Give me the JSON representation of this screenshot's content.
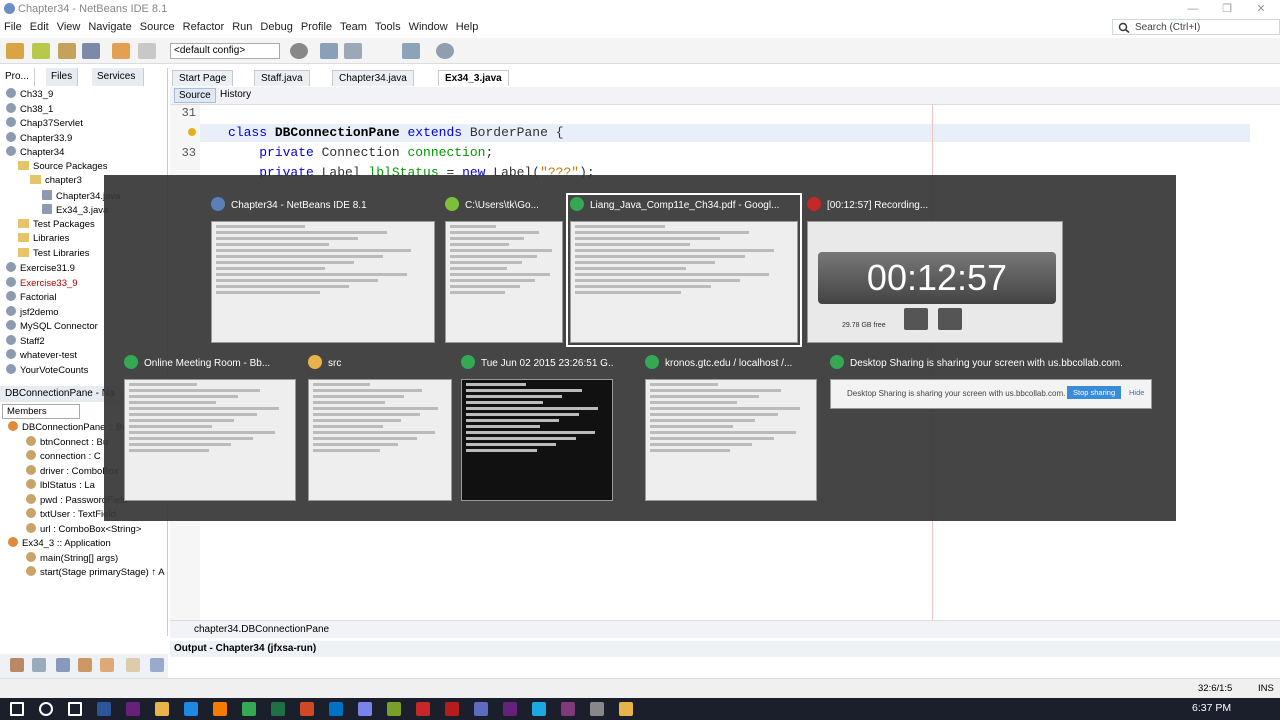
{
  "window": {
    "title": "Chapter34 - NetBeans IDE 8.1",
    "min": "—",
    "max": "❐",
    "close": "✕"
  },
  "menu": [
    "File",
    "Edit",
    "View",
    "Navigate",
    "Source",
    "Refactor",
    "Run",
    "Debug",
    "Profile",
    "Team",
    "Tools",
    "Window",
    "Help"
  ],
  "search": {
    "placeholder": "Search (Ctrl+I)"
  },
  "toolbar": {
    "config": "<default config>"
  },
  "left_tabs": [
    "Pro...",
    "Files",
    "Services"
  ],
  "projects": [
    {
      "label": "Ch33_9",
      "type": "proj"
    },
    {
      "label": "Ch38_1",
      "type": "proj"
    },
    {
      "label": "Chap37Servlet",
      "type": "proj"
    },
    {
      "label": "Chapter33.9",
      "type": "proj"
    },
    {
      "label": "Chapter34",
      "type": "proj"
    },
    {
      "label": "Source Packages",
      "type": "folder",
      "indent": 1
    },
    {
      "label": "chapter3",
      "type": "folder",
      "indent": 2
    },
    {
      "label": "Chapter34.java",
      "type": "file",
      "indent": 3
    },
    {
      "label": "Ex34_3.java",
      "type": "file",
      "indent": 3
    },
    {
      "label": "Test Packages",
      "type": "folder",
      "indent": 1
    },
    {
      "label": "Libraries",
      "type": "folder",
      "indent": 1
    },
    {
      "label": "Test Libraries",
      "type": "folder",
      "indent": 1
    },
    {
      "label": "Exercise31.9",
      "type": "proj"
    },
    {
      "label": "Exercise33_9",
      "type": "proj"
    },
    {
      "label": "Factorial",
      "type": "proj"
    },
    {
      "label": "jsf2demo",
      "type": "proj"
    },
    {
      "label": "MySQL Connector",
      "type": "proj"
    },
    {
      "label": "Staff2",
      "type": "proj"
    },
    {
      "label": "whatever-test",
      "type": "proj"
    },
    {
      "label": "YourVoteCounts",
      "type": "proj"
    }
  ],
  "navigator": {
    "title": "DBConnectionPane - Na",
    "members": "Members",
    "items": [
      {
        "label": "DBConnectionPane :: Bo",
        "indent": 0
      },
      {
        "label": "btnConnect : Bu",
        "indent": 1
      },
      {
        "label": "connection : C",
        "indent": 1
      },
      {
        "label": "driver : ComboBox",
        "indent": 1
      },
      {
        "label": "lblStatus : La",
        "indent": 1
      },
      {
        "label": "pwd : PasswordField",
        "indent": 1
      },
      {
        "label": "txtUser : TextField",
        "indent": 1
      },
      {
        "label": "url : ComboBox<String>",
        "indent": 1
      },
      {
        "label": "Ex34_3 :: Application",
        "indent": 0
      },
      {
        "label": "main(String[] args)",
        "indent": 1
      },
      {
        "label": "start(Stage primaryStage) ↑ A",
        "indent": 1
      }
    ]
  },
  "editor_tabs": [
    "Start Page",
    "Staff.java",
    "Chapter34.java",
    "Ex34_3.java"
  ],
  "source_tabs": [
    "Source",
    "History"
  ],
  "code": {
    "lines": [
      {
        "n": "31",
        "parts": []
      },
      {
        "n": "",
        "parts": [
          {
            "t": "class",
            "c": "kw"
          },
          {
            "t": " "
          },
          {
            "t": "DBConnectionPane",
            "c": "cls"
          },
          {
            "t": " "
          },
          {
            "t": "extends",
            "c": "kw"
          },
          {
            "t": " BorderPane {"
          }
        ]
      },
      {
        "n": "33",
        "parts": [
          {
            "t": "    "
          },
          {
            "t": "private",
            "c": "kw"
          },
          {
            "t": " Connection "
          },
          {
            "t": "connection",
            "c": "fld"
          },
          {
            "t": ";"
          }
        ]
      },
      {
        "n": "",
        "parts": [
          {
            "t": "    "
          },
          {
            "t": "private",
            "c": "kw"
          },
          {
            "t": " Label "
          },
          {
            "t": "lblStatus",
            "c": "fld"
          },
          {
            "t": " = "
          },
          {
            "t": "new",
            "c": "kw"
          },
          {
            "t": " Label("
          },
          {
            "t": "\"???\"",
            "c": "str"
          },
          {
            "t": ");"
          }
        ]
      }
    ]
  },
  "breadcrumb": "chapter34.DBConnectionPane",
  "output_tab": "Output - Chapter34 (jfxsa-run)",
  "status": {
    "pos": "32:6/1:5",
    "mode": "INS"
  },
  "taskbar": {
    "time": "6:37 PM"
  },
  "switcher": {
    "row1": [
      {
        "title": "Chapter34 - NetBeans IDE 8.1",
        "icon": "netbeans-icon"
      },
      {
        "title": "C:\\Users\\tk\\Go...",
        "icon": "notepad-icon"
      },
      {
        "title": "Liang_Java_Comp11e_Ch34.pdf - Googl...",
        "icon": "chrome-icon",
        "selected": true
      },
      {
        "title": "[00:12:57] Recording...",
        "icon": "recorder-icon"
      }
    ],
    "row2": [
      {
        "title": "Online Meeting Room - Bb...",
        "icon": "chrome-icon"
      },
      {
        "title": "src",
        "icon": "folder-icon"
      },
      {
        "title": "Tue Jun 02 2015 23:26:51 G...",
        "icon": "chrome-icon"
      },
      {
        "title": "kronos.gtc.edu / localhost /...",
        "icon": "chrome-icon"
      },
      {
        "title": "Desktop Sharing is sharing your screen with us.bbcollab.com.",
        "icon": "chrome-icon"
      }
    ],
    "recorder": {
      "time": "00:12:57",
      "free": "29.78 GB free"
    },
    "sharing": {
      "text": "Desktop Sharing is sharing your screen with us.bbcollab.com.",
      "stop": "Stop sharing",
      "hide": "Hide"
    }
  }
}
